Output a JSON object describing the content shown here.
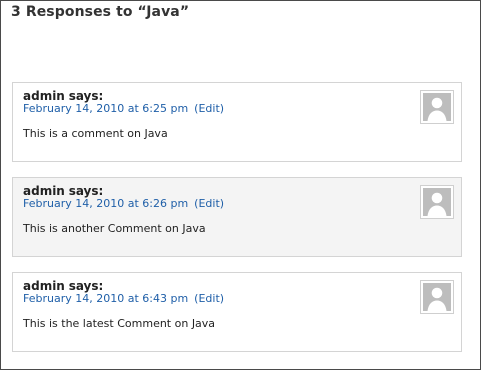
{
  "heading": "3 Responses to “Java”",
  "comments": [
    {
      "author": "admin",
      "says": "says:",
      "date": "February 14, 2010 at 6:25 pm",
      "edit_open": "(",
      "edit_label": "Edit",
      "edit_close": ")",
      "text": "This is a comment on Java",
      "avatar_icon": "default-avatar-icon"
    },
    {
      "author": "admin",
      "says": "says:",
      "date": "February 14, 2010 at 6:26 pm",
      "edit_open": "(",
      "edit_label": "Edit",
      "edit_close": ")",
      "text": "This is another Comment on Java",
      "avatar_icon": "default-avatar-icon"
    },
    {
      "author": "admin",
      "says": "says:",
      "date": "February 14, 2010 at 6:43 pm",
      "edit_open": "(",
      "edit_label": "Edit",
      "edit_close": ")",
      "text": "This is the latest Comment on Java",
      "avatar_icon": "default-avatar-icon"
    }
  ],
  "colors": {
    "link": "#1f5fa8",
    "text": "#222222",
    "border": "#d4d4d4",
    "alt_background": "#f4f4f4"
  }
}
